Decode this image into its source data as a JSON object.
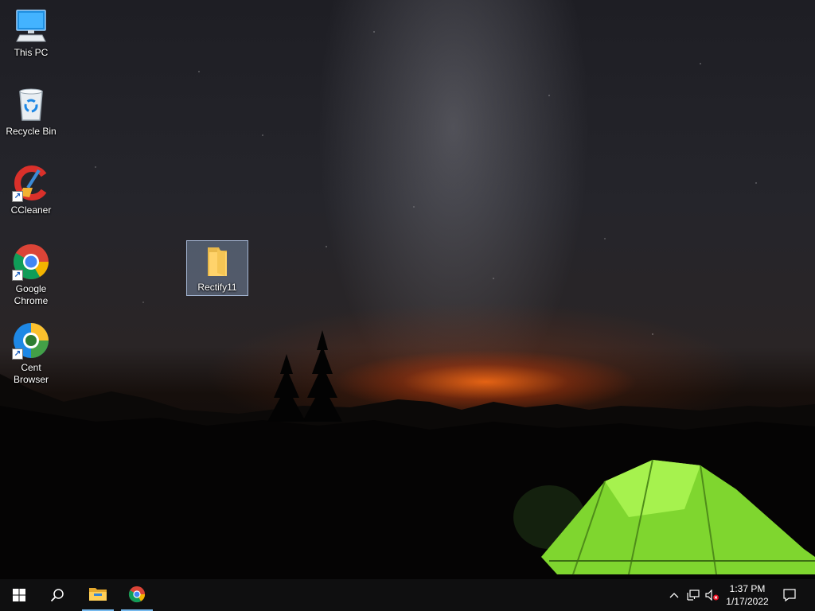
{
  "desktop": {
    "icons": [
      {
        "label": "This PC",
        "icon": "computer-icon",
        "shortcut": false
      },
      {
        "label": "Recycle Bin",
        "icon": "recycle-bin-icon",
        "shortcut": false
      },
      {
        "label": "CCleaner",
        "icon": "ccleaner-icon",
        "shortcut": true
      },
      {
        "label": "Google Chrome",
        "icon": "chrome-icon",
        "shortcut": true
      },
      {
        "label": "Cent Browser",
        "icon": "cent-browser-icon",
        "shortcut": true
      },
      {
        "label": "Rectify11",
        "icon": "folder-icon",
        "shortcut": false,
        "selected": true
      }
    ]
  },
  "taskbar": {
    "start_icon": "windows-start-icon",
    "search_icon": "search-icon",
    "pinned": [
      {
        "name": "File Explorer",
        "icon": "file-explorer-icon",
        "running": true
      },
      {
        "name": "Google Chrome",
        "icon": "chrome-icon",
        "running": true
      }
    ],
    "tray": {
      "icons": [
        "chevron-up-icon",
        "network-icon",
        "volume-muted-icon"
      ],
      "time": "1:37 PM",
      "date": "1/17/2022",
      "notification_icon": "action-center-icon"
    }
  },
  "colors": {
    "taskbar_bg": "#0f0f10",
    "active_indicator": "#76b9ed",
    "tent_green": "#8ee83a",
    "sunset_orange": "#ff6e14"
  }
}
